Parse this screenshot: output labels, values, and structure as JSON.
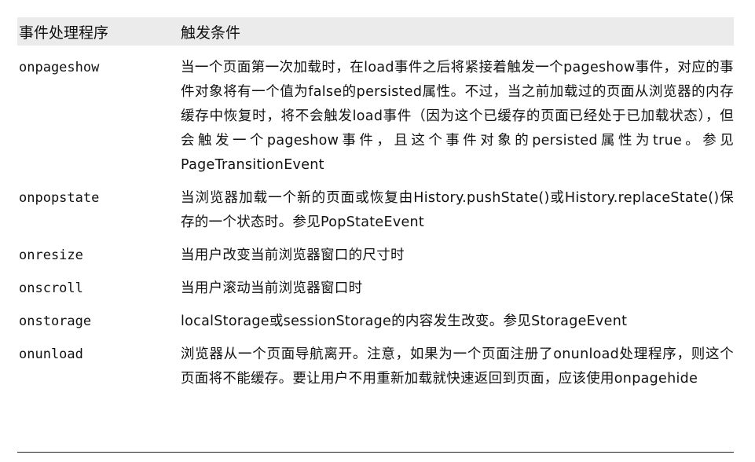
{
  "table": {
    "header": {
      "col1": "事件处理程序",
      "col2": "触发条件"
    },
    "rows": [
      {
        "name": "onpageshow",
        "desc": "当一个页面第一次加载时，在load事件之后将紧接着触发一个pageshow事件，对应的事件对象将有一个值为false的persisted属性。不过，当之前加载过的页面从浏览器的内存缓存中恢复时，将不会触发load事件（因为这个已缓存的页面已经处于已加载状态），但会触发一个pageshow事件，且这个事件对象的persisted属性为true。参见PageTransitionEvent"
      },
      {
        "name": "onpopstate",
        "desc": "当浏览器加载一个新的页面或恢复由History.pushState()或History.replaceState()保存的一个状态时。参见PopStateEvent"
      },
      {
        "name": "onresize",
        "desc": "当用户改变当前浏览器窗口的尺寸时"
      },
      {
        "name": "onscroll",
        "desc": "当用户滚动当前浏览器窗口时"
      },
      {
        "name": "onstorage",
        "desc": "localStorage或sessionStorage的内容发生改变。参见StorageEvent"
      },
      {
        "name": "onunload",
        "desc": "浏览器从一个页面导航离开。注意，如果为一个页面注册了onunload处理程序，则这个页面将不能缓存。要让用户不用重新加载就快速返回到页面，应该使用onpagehide"
      }
    ]
  }
}
